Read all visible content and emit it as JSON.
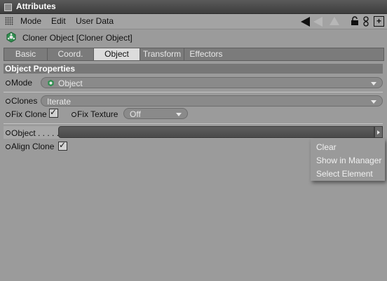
{
  "window": {
    "title": "Attributes"
  },
  "menu": {
    "items": [
      "Mode",
      "Edit",
      "User Data"
    ]
  },
  "object_header": {
    "title": "Cloner Object [Cloner Object]"
  },
  "tabs": [
    {
      "label": "Basic",
      "active": false
    },
    {
      "label": "Coord.",
      "active": false
    },
    {
      "label": "Object",
      "active": true
    },
    {
      "label": "Transform",
      "active": false
    },
    {
      "label": "Effectors",
      "active": false
    }
  ],
  "section": {
    "title": "Object Properties"
  },
  "properties": {
    "mode": {
      "label": "Mode",
      "value": "Object"
    },
    "clones": {
      "label": "Clones",
      "value": "Iterate"
    },
    "fix_clone": {
      "label": "Fix Clone",
      "checked": true
    },
    "fix_texture": {
      "label": "Fix Texture",
      "value": "Off"
    },
    "object": {
      "label": "Object . . . . ."
    },
    "align_clone": {
      "label": "Align Clone",
      "checked": true
    }
  },
  "context_menu": {
    "items": [
      "Clear",
      "Show in Manager",
      "Select Element"
    ]
  },
  "colors": {
    "background": "#9b9b9b",
    "titlebar": "#4a4a4a",
    "section": "#777777",
    "link_field": "#555555"
  },
  "icons": [
    "grip-icon",
    "back-arrow-icon",
    "forward-arrow-icon",
    "up-arrow-icon",
    "lock-icon",
    "dots-icon",
    "new-panel-icon",
    "cloner-icon"
  ]
}
